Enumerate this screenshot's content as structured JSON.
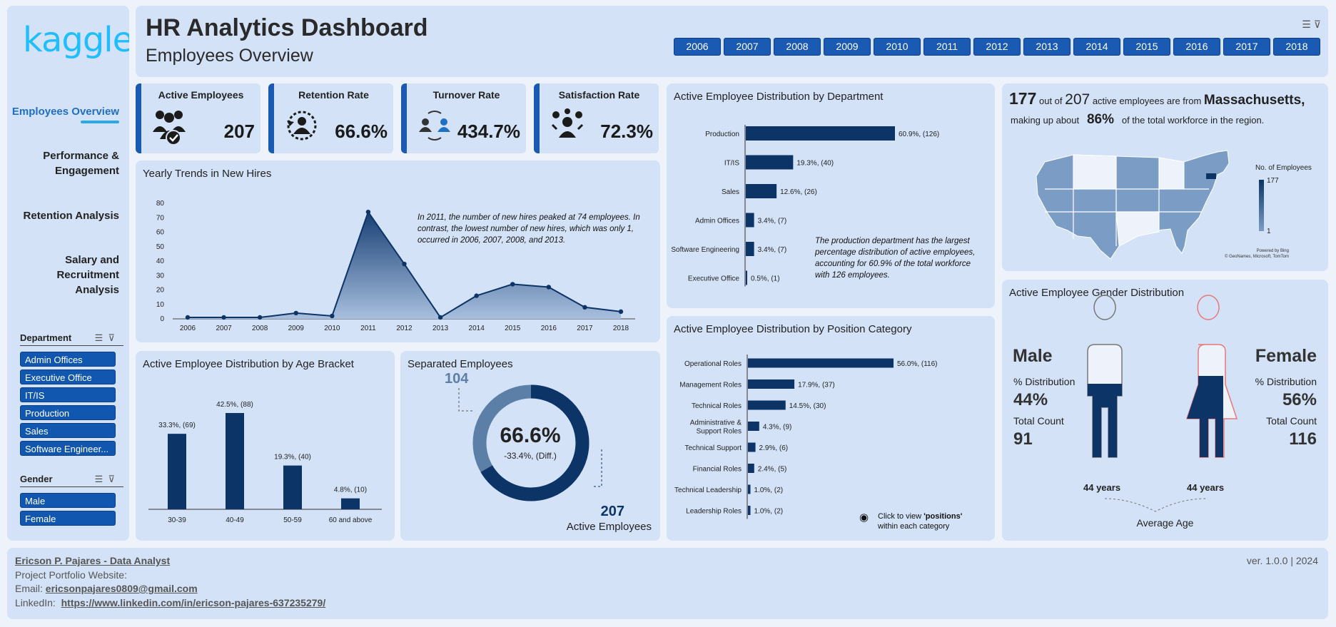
{
  "sidebar": {
    "logo": "kaggle",
    "nav": [
      "Employees Overview",
      "Performance & Engagement",
      "Retention Analysis",
      "Salary and Recruitment Analysis"
    ],
    "department": {
      "title": "Department",
      "items": [
        "Admin Offices",
        "Executive Office",
        "IT/IS",
        "Production",
        "Sales",
        "Software Engineer..."
      ]
    },
    "gender": {
      "title": "Gender",
      "items": [
        "Male",
        "Female"
      ]
    }
  },
  "header": {
    "title": "HR Analytics Dashboard",
    "subtitle": "Employees Overview",
    "years": [
      "2006",
      "2007",
      "2008",
      "2009",
      "2010",
      "2011",
      "2012",
      "2013",
      "2014",
      "2015",
      "2016",
      "2017",
      "2018"
    ]
  },
  "kpis": {
    "active": {
      "label": "Active Employees",
      "value": "207",
      "icon": "employees-check-icon"
    },
    "retention": {
      "label": "Retention Rate",
      "value": "66.6%",
      "icon": "retention-icon"
    },
    "turnover": {
      "label": "Turnover Rate",
      "value": "434.7%",
      "icon": "turnover-icon"
    },
    "satisfaction": {
      "label": "Satisfaction Rate",
      "value": "72.3%",
      "icon": "satisfaction-icon"
    }
  },
  "new_hires": {
    "title": "Yearly Trends in New Hires",
    "note": "In 2011, the number of new hires peaked at 74 employees. In contrast, the lowest number of new hires, which was only 1, occurred in 2006, 2007, 2008, and 2013."
  },
  "age": {
    "title": "Active Employee Distribution by Age Bracket"
  },
  "separated": {
    "title": "Separated Employees",
    "separated_count": "104",
    "center_value": "66.6%",
    "center_sub": "-33.4%, (Diff.)",
    "active_count": "207",
    "active_label": "Active Employees",
    "retained_fraction": 0.666
  },
  "department": {
    "title": "Active Employee Distribution by Department",
    "note": "The production department has the largest percentage distribution of active employees, accounting for 60.9% of the total workforce with 126 employees."
  },
  "position": {
    "title": "Active Employee Distribution by Position Category",
    "click_text": "Click to view ",
    "click_bold": "'positions'",
    "click_text2": "within each category"
  },
  "map": {
    "count": "177",
    "out_of": "out of",
    "total": "207",
    "text1": "active employees are from",
    "state": "Massachusetts,",
    "text2": "making up about",
    "pct": "86%",
    "text3": "of the total workforce in the region.",
    "legend_title": "No. of Employees",
    "legend_max": "177",
    "legend_min": "1",
    "attribution1": "Powered by Bing",
    "attribution2": "© GeoNames, Microsoft, TomTom"
  },
  "gender": {
    "title": "Active Employee Gender Distribution",
    "male": {
      "label": "Male",
      "dist_label": "% Distribution",
      "dist": "44%",
      "count_label": "Total Count",
      "count": "91",
      "age": "44 years"
    },
    "female": {
      "label": "Female",
      "dist_label": "% Distribution",
      "dist": "56%",
      "count_label": "Total Count",
      "count": "116",
      "age": "44 years"
    },
    "avg_label": "Average Age"
  },
  "footer": {
    "name": "Ericson P. Pajares - Data Analyst",
    "portfolio": "Project Portfolio Website:",
    "email_label": "Email:",
    "email": "ericsonpajares0809@gmail.com",
    "linkedin_label": "LinkedIn:",
    "linkedin": "https://www.linkedin.com/in/ericson-pajares-637235279/",
    "version": "ver. 1.0.0 | 2024"
  },
  "colors": {
    "accent": "#1a5ab2",
    "bar": "#0d3466",
    "panel": "#d3e2f7",
    "female": "#e7797b"
  },
  "chart_data": [
    {
      "type": "area",
      "title": "Yearly Trends in New Hires",
      "x": [
        "2006",
        "2007",
        "2008",
        "2009",
        "2010",
        "2011",
        "2012",
        "2013",
        "2014",
        "2015",
        "2016",
        "2017",
        "2018"
      ],
      "values": [
        1,
        1,
        1,
        4,
        2,
        74,
        38,
        1,
        16,
        24,
        22,
        8,
        5
      ],
      "yticks": [
        0,
        10,
        20,
        30,
        40,
        50,
        60,
        70,
        80
      ],
      "ylim": [
        0,
        80
      ]
    },
    {
      "type": "bar",
      "orientation": "horizontal",
      "title": "Active Employee Distribution by Department",
      "categories": [
        "Production",
        "IT/IS",
        "Sales",
        "Admin Offices",
        "Software Engineering",
        "Executive Office"
      ],
      "values": [
        126,
        40,
        26,
        7,
        7,
        1
      ],
      "labels": [
        "60.9%, (126)",
        "19.3%, (40)",
        "12.6%, (26)",
        "3.4%, (7)",
        "3.4%, (7)",
        "0.5%, (1)"
      ]
    },
    {
      "type": "bar",
      "orientation": "horizontal",
      "title": "Active Employee Distribution by Position Category",
      "categories": [
        "Operational Roles",
        "Management Roles",
        "Technical Roles",
        "Administrative & Support Roles",
        "Technical Support",
        "Financial Roles",
        "Technical Leadership",
        "Leadership Roles"
      ],
      "values": [
        116,
        37,
        30,
        9,
        6,
        5,
        2,
        2
      ],
      "labels": [
        "56.0%, (116)",
        "17.9%, (37)",
        "14.5%, (30)",
        "4.3%, (9)",
        "2.9%, (6)",
        "2.4%, (5)",
        "1.0%, (2)",
        "1.0%, (2)"
      ]
    },
    {
      "type": "bar",
      "title": "Active Employee Distribution by Age Bracket",
      "categories": [
        "30-39",
        "40-49",
        "50-59",
        "60 and above"
      ],
      "values": [
        69,
        88,
        40,
        10
      ],
      "labels": [
        "33.3%, (69)",
        "42.5%, (88)",
        "19.3%, (40)",
        "4.8%, (10)"
      ]
    }
  ]
}
